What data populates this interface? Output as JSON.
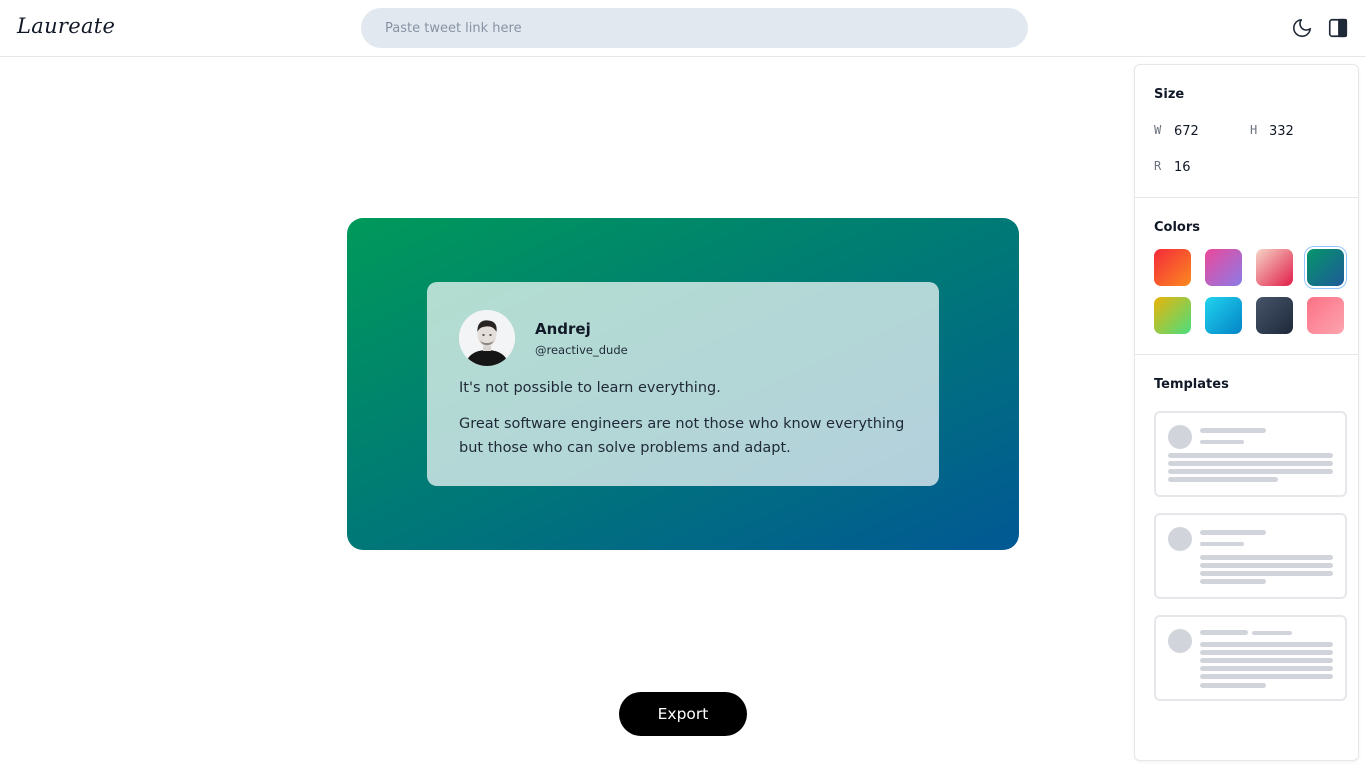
{
  "app": {
    "logo": "Laureate"
  },
  "header": {
    "search_placeholder": "Paste tweet link here"
  },
  "tweet": {
    "author": "Andrej",
    "handle": "@reactive_dude",
    "paragraphs": [
      "It's not possible to learn everything.",
      "Great software engineers are not those who know everything but those who can solve problems and adapt."
    ]
  },
  "export_label": "Export",
  "sidebar": {
    "size": {
      "title": "Size",
      "w_label": "W",
      "w_value": "672",
      "h_label": "H",
      "h_value": "332",
      "r_label": "R",
      "r_value": "16"
    },
    "colors": {
      "title": "Colors",
      "selected_index": 3,
      "swatches": [
        {
          "from": "#f4293b",
          "to": "#fb8a1e"
        },
        {
          "from": "#ec4899",
          "to": "#8b7be8"
        },
        {
          "from": "#f6d5c7",
          "to": "#e11d48"
        },
        {
          "from": "#059669",
          "to": "#1e5a9a"
        },
        {
          "from": "#eab308",
          "to": "#4ade80"
        },
        {
          "from": "#22d3ee",
          "to": "#0284c7"
        },
        {
          "from": "#475569",
          "to": "#1e293b"
        },
        {
          "from": "#fb7185",
          "to": "#fda4af"
        }
      ]
    },
    "templates": {
      "title": "Templates"
    }
  },
  "canvas": {
    "gradient_from": "#00995a",
    "gradient_to": "#015894"
  }
}
